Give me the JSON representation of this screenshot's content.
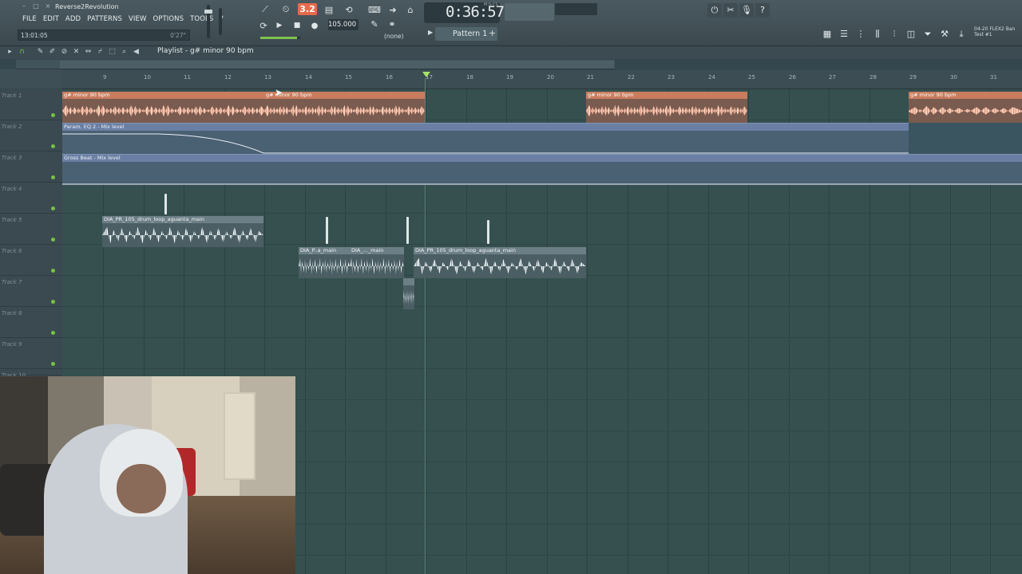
{
  "window": {
    "title": "Reverse2Revolution",
    "controls": [
      "–",
      "□",
      "×"
    ]
  },
  "menu": [
    "FILE",
    "EDIT",
    "ADD",
    "PATTERNS",
    "VIEW",
    "OPTIONS",
    "TOOLS",
    "?"
  ],
  "hint_bar": {
    "left": "13:01:05",
    "right": "0'27\""
  },
  "transport": {
    "record_count": "3.2",
    "tempo": "105.000",
    "snap": "(none)",
    "time": "0:36:57",
    "time_label": "M:S:CS",
    "pattern": "Pattern 1"
  },
  "news": {
    "line1": "04-20 FLEX2 Ban",
    "line2": "Test #1"
  },
  "playlist": {
    "title": "Playlist - g# minor 90 bpm",
    "bars": [
      "9",
      "10",
      "11",
      "12",
      "13",
      "14",
      "15",
      "16",
      "17",
      "18",
      "19",
      "20",
      "21",
      "22",
      "23",
      "24",
      "25",
      "26",
      "27",
      "28",
      "29",
      "30",
      "31"
    ]
  },
  "tracks": [
    "Track 1",
    "Track 2",
    "Track 3",
    "Track 4",
    "Track 5",
    "Track 6",
    "Track 7",
    "Track 8",
    "Track 9",
    "Track 10"
  ],
  "clips": {
    "audio_main": "g# minor 90 bpm",
    "audio_2": "g# minor 90 bpm",
    "audio_3": "g# minor 90 bpm",
    "audio_4": "g# minor 90 bpm",
    "auto_eq": "Param. EQ 2 - Mix level",
    "auto_gross": "Gross Beat - Mix level",
    "drum_1": "DIA_PR_105_drum_loop_aguanta_main",
    "drum_2": "DIA_P..a_main",
    "drum_3": "DIA_..._main",
    "drum_4": "DIA_PR_105_drum_loop_aguanta_main"
  },
  "colors": {
    "accent_green": "#7ac146",
    "record": "#e86a4c",
    "audio_clip": "#c97c5e",
    "automation_clip": "#6a7fa3"
  }
}
